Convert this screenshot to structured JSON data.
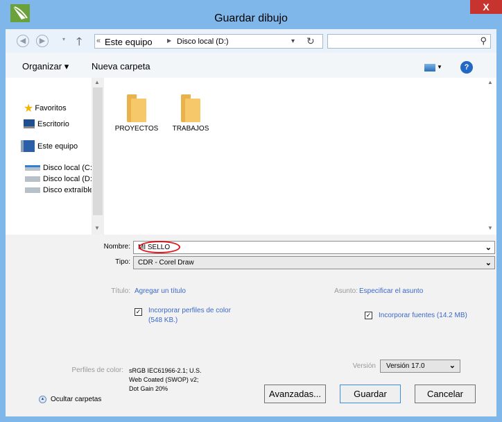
{
  "window": {
    "title": "Guardar dibujo",
    "close_label": "X"
  },
  "nav": {
    "breadcrumb_prefix": "«",
    "crumb_root": "Este equipo",
    "crumb_current": "Disco local (D:)",
    "search_value": ""
  },
  "toolbar": {
    "organize": "Organizar ▾",
    "new_folder": "Nueva carpeta"
  },
  "sidebar": {
    "items": [
      {
        "label": "Favoritos",
        "icon": "star-icon"
      },
      {
        "label": "Escritorio",
        "icon": "desktop-icon"
      },
      {
        "label": "Este equipo",
        "icon": "computer-icon"
      },
      {
        "label": "Disco local (C:)",
        "icon": "drive-icon"
      },
      {
        "label": "Disco local (D:)",
        "icon": "drive-icon"
      },
      {
        "label": "Disco extraíble",
        "icon": "drive-icon"
      }
    ]
  },
  "files": [
    {
      "name": "PROYECTOS",
      "icon": "folder-icon"
    },
    {
      "name": "TRABAJOS",
      "icon": "folder-icon"
    }
  ],
  "form": {
    "name_label": "Nombre:",
    "name_value": "MI SELLO",
    "type_label": "Tipo:",
    "type_value": "CDR - Corel Draw",
    "title_label": "Título:",
    "title_link": "Agregar un título",
    "subject_label": "Asunto:",
    "subject_link": "Especificar el asunto",
    "embed_profiles_line1": "Incorporar perfiles de color",
    "embed_profiles_line2": "(548 KB.)",
    "embed_profiles_checked": true,
    "embed_fonts": "Incorporar fuentes (14.2 MB)",
    "embed_fonts_checked": true,
    "profiles_label": "Perfiles de color:",
    "profiles_line1": "sRGB IEC61966-2.1; U.S.",
    "profiles_line2": "Web Coated (SWOP) v2;",
    "profiles_line3": "Dot Gain 20%",
    "version_label": "Versión",
    "version_value": "Versión 17.0",
    "hide_folders": "Ocultar carpetas",
    "advanced_button": "Avanzadas...",
    "save_button": "Guardar",
    "cancel_button": "Cancelar"
  },
  "colors": {
    "frame": "#7fb7ea",
    "close": "#c7342f",
    "link": "#3b68c9",
    "highlight": "#e1151c"
  }
}
